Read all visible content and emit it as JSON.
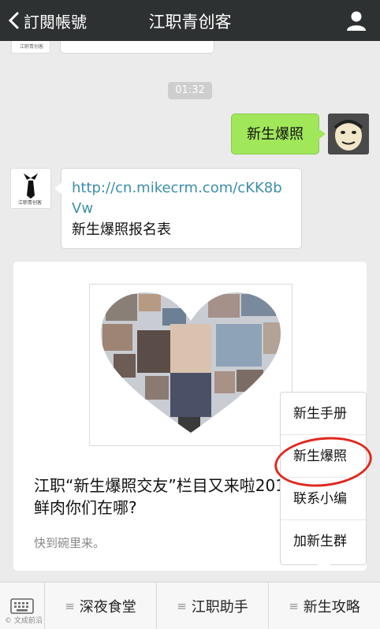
{
  "header": {
    "back_label": "訂閱帳號",
    "title": "江职青创客"
  },
  "chat": {
    "timestamp": "01:32",
    "outgoing": "新生爆照",
    "account_avatar_text": "江职青创客",
    "link": "http://cn.mikecrm.com/cKK8bVw",
    "link_caption": "新生爆照报名表",
    "article": {
      "title": "江职“新生爆照交友”栏目又来啦2018级的小鲜肉你们在哪?",
      "desc": "快到碗里来。"
    }
  },
  "popup": {
    "items": [
      "新生手册",
      "新生爆照",
      "联系小编",
      "加新生群"
    ]
  },
  "bottom": {
    "tabs": [
      "深夜食堂",
      "江职助手",
      "新生攻略"
    ]
  },
  "watermark": "© 文成前沿"
}
